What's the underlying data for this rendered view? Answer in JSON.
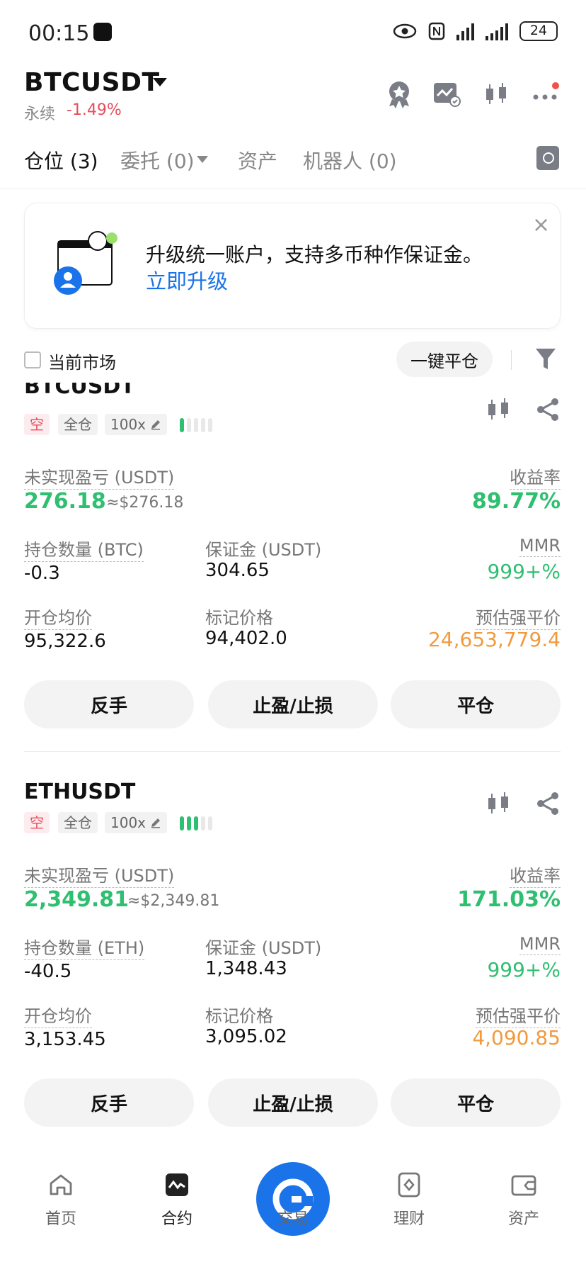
{
  "status_bar": {
    "time": "00:15",
    "battery": "24"
  },
  "header": {
    "pair": "BTCUSDT",
    "contract_type": "永续",
    "change": "-1.49%"
  },
  "tabs": [
    {
      "label": "仓位 (3)"
    },
    {
      "label": "委托 (0)"
    },
    {
      "label": "资产"
    },
    {
      "label": "机器人 (0)"
    }
  ],
  "banner": {
    "text": "升级统一账户，支持多币种作保证金。",
    "link": "立即升级",
    "close": "×"
  },
  "filter": {
    "current_market": "当前市场",
    "close_all": "一键平仓"
  },
  "labels": {
    "unrealized_pnl": "未实现盈亏 (USDT)",
    "roe": "收益率",
    "margin": "保证金 (USDT)",
    "mmr": "MMR",
    "entry_price": "开仓均价",
    "mark_price": "标记价格",
    "liq_price": "预估强平价"
  },
  "positions": [
    {
      "symbol": "BTCUSDT",
      "side": "空",
      "mode": "全仓",
      "leverage": "100x",
      "pnl": "276.18",
      "pnl_usd": "≈$276.18",
      "roe": "89.77%",
      "qty_label": "持仓数量 (BTC)",
      "qty": "-0.3",
      "margin": "304.65",
      "mmr": "999+%",
      "entry": "95,322.6",
      "mark": "94,402.0",
      "liq": "24,653,779.4",
      "risk_level": 1,
      "actions": {
        "reverse": "反手",
        "tpsl": "止盈/止损",
        "close": "平仓"
      }
    },
    {
      "symbol": "ETHUSDT",
      "side": "空",
      "mode": "全仓",
      "leverage": "100x",
      "pnl": "2,349.81",
      "pnl_usd": "≈$2,349.81",
      "roe": "171.03%",
      "qty_label": "持仓数量 (ETH)",
      "qty": "-40.5",
      "margin": "1,348.43",
      "mmr": "999+%",
      "entry": "3,153.45",
      "mark": "3,095.02",
      "liq": "4,090.85",
      "risk_level": 3,
      "actions": {
        "reverse": "反手",
        "tpsl": "止盈/止损",
        "close": "平仓"
      }
    }
  ],
  "bottom_nav": [
    {
      "label": "首页",
      "icon": "home-icon"
    },
    {
      "label": "合约",
      "icon": "futures-icon"
    },
    {
      "label": "交易",
      "icon": "trade-icon"
    },
    {
      "label": "理财",
      "icon": "earn-icon"
    },
    {
      "label": "资产",
      "icon": "wallet-icon"
    }
  ],
  "colors": {
    "accent": "#1a73e8",
    "profit": "#2fbf71",
    "loss": "#e84c5d",
    "warning": "#f19a3e"
  }
}
